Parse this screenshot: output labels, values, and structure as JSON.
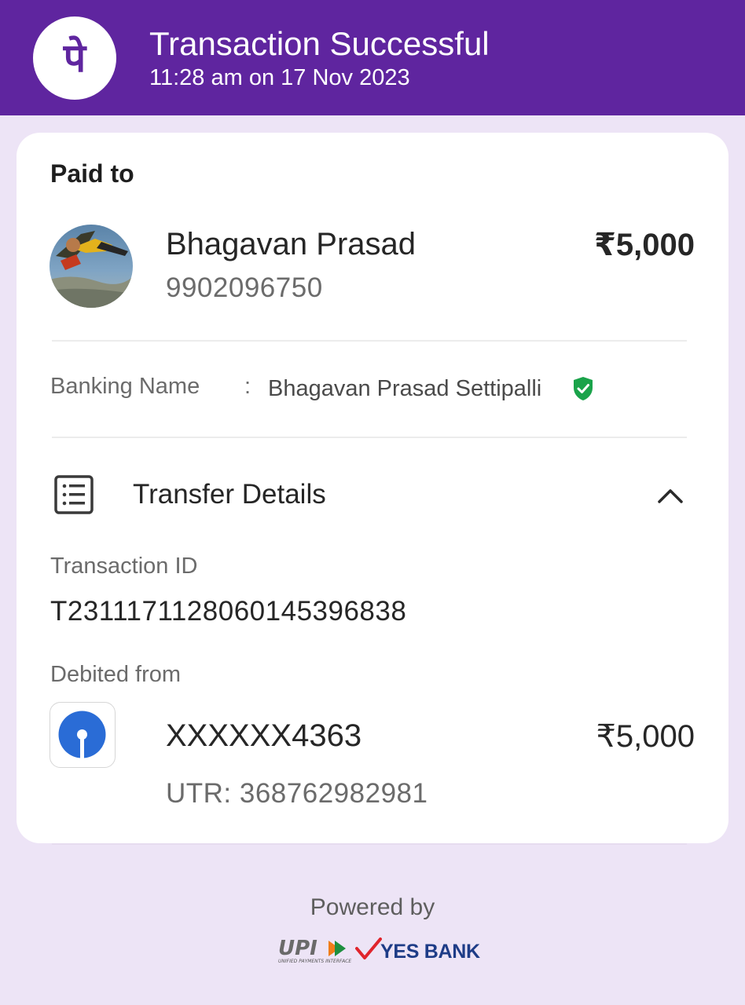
{
  "header": {
    "title": "Transaction Successful",
    "datetime": "11:28 am on 17 Nov 2023",
    "logo_glyph": "पे",
    "brand_color": "#5f259f"
  },
  "paid_to": {
    "label": "Paid to",
    "name": "Bhagavan Prasad",
    "phone": "9902096750",
    "amount": "₹5,000"
  },
  "banking_name": {
    "label": "Banking Name",
    "separator": ":",
    "value": "Bhagavan Prasad Settipalli",
    "verified_icon": "shield-check-icon",
    "verified_color": "#1aa34a"
  },
  "transfer_details": {
    "title": "Transfer Details",
    "icon": "document-list-icon",
    "toggle_icon": "chevron-up-icon",
    "transaction_id_label": "Transaction ID",
    "transaction_id": "T2311171128060145396838",
    "debited_from_label": "Debited from",
    "account": "XXXXXX4363",
    "amount": "₹5,000",
    "utr": "UTR: 368762982981",
    "bank_icon": "sbi-logo-icon"
  },
  "footer": {
    "powered_by": "Powered by",
    "upi_text": "UPI",
    "upi_subtext": "UNIFIED PAYMENTS INTERFACE",
    "bank_text": "YES BANK"
  }
}
